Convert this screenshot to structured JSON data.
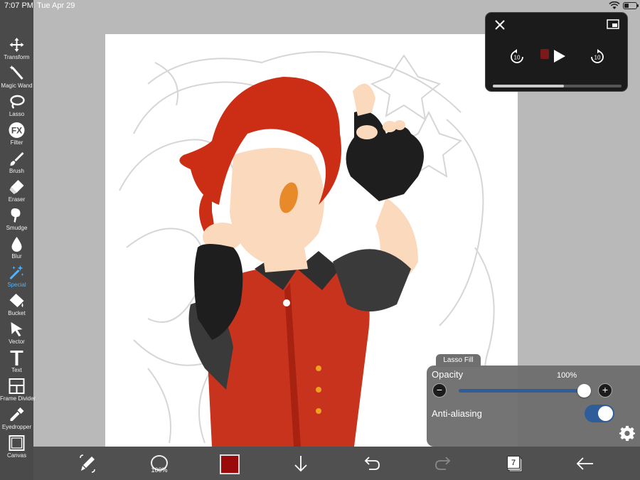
{
  "status_bar": {
    "time": "7:07 PM",
    "date": "Tue Apr 29"
  },
  "toolbar": {
    "tools": [
      {
        "label": "Transform",
        "icon": "move-arrows-icon"
      },
      {
        "label": "Magic Wand",
        "icon": "magic-wand-icon"
      },
      {
        "label": "Lasso",
        "icon": "lasso-icon"
      },
      {
        "label": "Filter",
        "icon": "fx-icon"
      },
      {
        "label": "Brush",
        "icon": "brush-icon"
      },
      {
        "label": "Eraser",
        "icon": "eraser-icon"
      },
      {
        "label": "Smudge",
        "icon": "smudge-icon"
      },
      {
        "label": "Blur",
        "icon": "droplet-icon"
      },
      {
        "label": "Special",
        "icon": "sparkle-wand-icon",
        "active": true
      },
      {
        "label": "Bucket",
        "icon": "bucket-icon"
      },
      {
        "label": "Vector",
        "icon": "cursor-icon"
      },
      {
        "label": "Text",
        "icon": "text-t-icon"
      },
      {
        "label": "Frame Divider",
        "icon": "frame-divider-icon"
      },
      {
        "label": "Eyedropper",
        "icon": "eyedropper-icon"
      },
      {
        "label": "Canvas",
        "icon": "canvas-icon"
      }
    ],
    "active_color": "#4fb3ff"
  },
  "bottom_bar": {
    "brush_size_label": "100%",
    "current_color": "#9b0a0a",
    "layer_count": "7"
  },
  "video_pip": {
    "progress": 0.55
  },
  "lasso_panel": {
    "tab_label": "Lasso Fill",
    "opacity_label": "Opacity",
    "opacity_value": "100%",
    "opacity_fraction": 1.0,
    "anti_aliasing_label": "Anti-aliasing",
    "anti_aliasing_on": true
  }
}
